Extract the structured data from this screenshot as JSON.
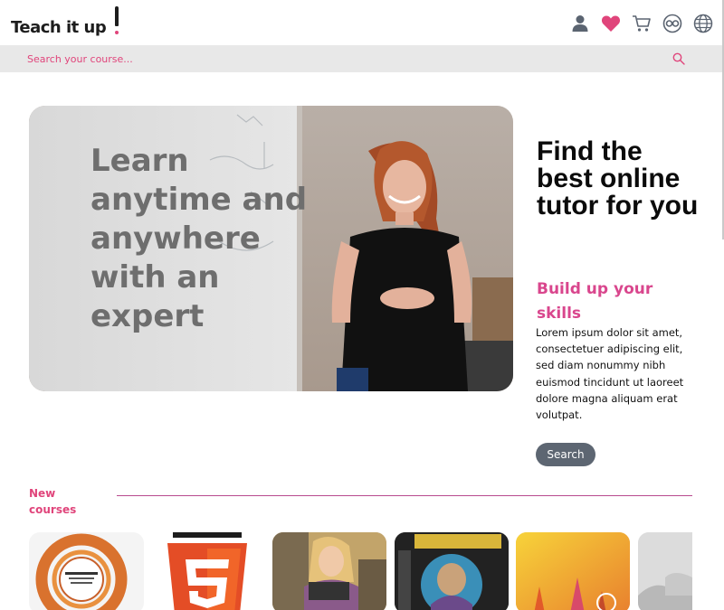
{
  "header": {
    "logo_text": "Teach it up",
    "icons": [
      "user-icon",
      "heart-icon",
      "cart-icon",
      "currency-icon",
      "globe-icon"
    ]
  },
  "search": {
    "placeholder": "Search your course..."
  },
  "hero": {
    "headline": "Learn anytime and anywhere with an expert"
  },
  "promo": {
    "title": "Find the best online tutor for you",
    "subtitle": "Build up your skills",
    "body": "Lorem ipsum dolor sit amet, consectetuer adipiscing elit, sed diam nonummy nibh euismod tincidunt ut laoreet dolore magna aliquam erat volutpat.",
    "button_label": "Search"
  },
  "courses": {
    "section_label": "New courses"
  },
  "colors": {
    "accent": "#e0457b",
    "subtitle": "#d9468d",
    "button": "#5d6672",
    "searchbar": "#e8e8e8"
  }
}
